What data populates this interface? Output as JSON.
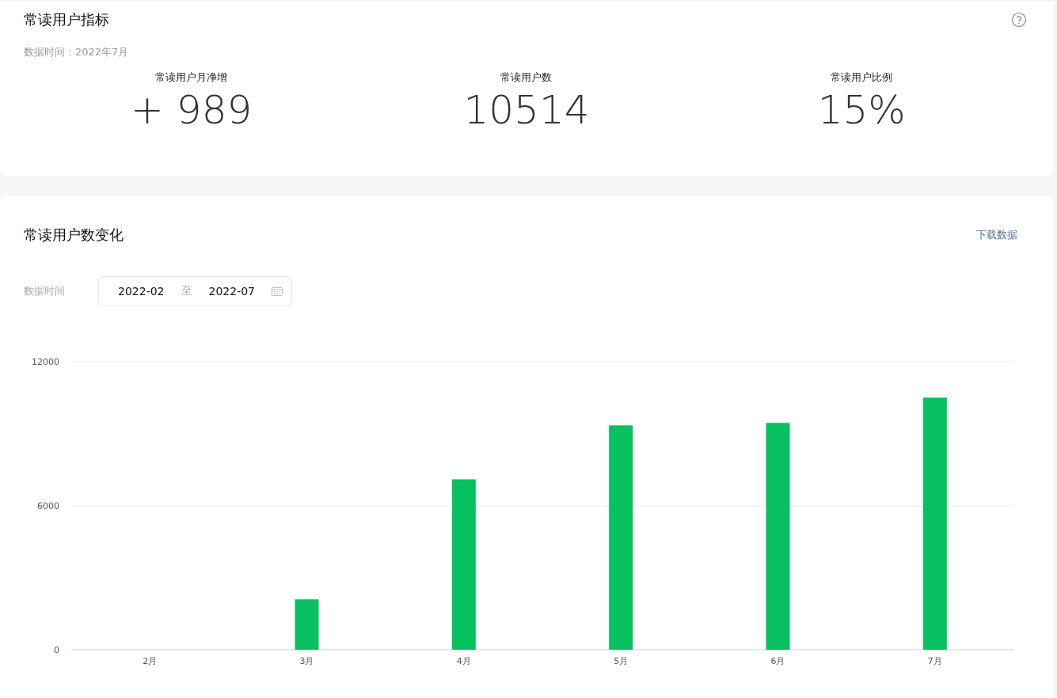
{
  "overview": {
    "title": "常读用户指标",
    "data_time": "数据时间：2022年7月",
    "metrics": [
      {
        "label": "常读用户月净增",
        "value": "+ 989"
      },
      {
        "label": "常读用户数",
        "value": "10514"
      },
      {
        "label": "常读用户比例",
        "value": "15%"
      }
    ]
  },
  "trend": {
    "title": "常读用户数变化",
    "download_link": "下载数据",
    "filter_label": "数据时间",
    "range_start": "2022-02",
    "range_separator": "至",
    "range_end": "2022-07",
    "chart_data": {
      "type": "bar",
      "categories": [
        "2月",
        "3月",
        "4月",
        "5月",
        "6月",
        "7月"
      ],
      "series": [
        {
          "color": "#07c160",
          "values": [
            0,
            2100,
            7100,
            9350,
            9450,
            10500
          ]
        }
      ],
      "ylim": [
        0,
        12000
      ],
      "yticks": [
        0,
        6000,
        12000
      ]
    }
  }
}
